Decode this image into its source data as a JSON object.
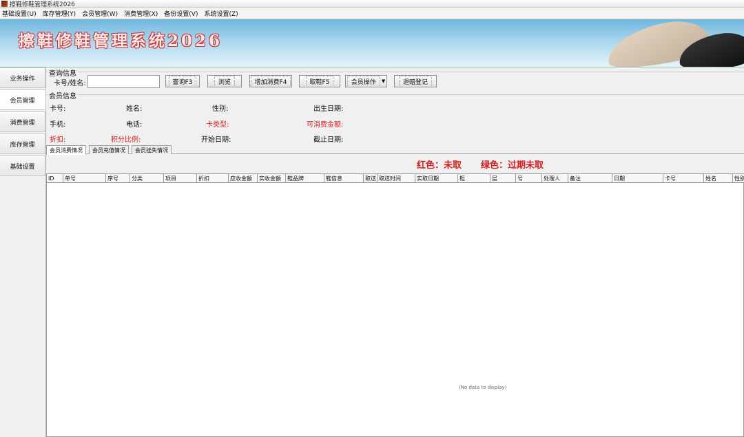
{
  "window": {
    "title": "擦鞋修鞋管理系统2026"
  },
  "menu": [
    "基础设置(U)",
    "库存管理(Y)",
    "会员管理(W)",
    "消费管理(X)",
    "备份设置(V)",
    "系统设置(Z)"
  ],
  "banner": {
    "title": "擦鞋修鞋管理系统2026"
  },
  "sidebar": {
    "items": [
      "业务操作",
      "会员管理",
      "消费管理",
      "库存管理",
      "基础设置"
    ],
    "active": 1
  },
  "query": {
    "group_label": "查询信息",
    "card_label": "卡号/姓名:",
    "card_value": "",
    "buttons": {
      "query": "查询F3",
      "browse": "浏览",
      "add_consume": "增加消费F4",
      "take_shoes": "取鞋F5",
      "member_ops": "会员操作",
      "refund": "退赔登记"
    }
  },
  "member": {
    "group_label": "会员信息",
    "fields": {
      "card_no": "卡号:",
      "name": "姓名:",
      "gender": "性别:",
      "birth": "出生日期:",
      "mobile": "手机:",
      "phone": "电话:",
      "card_type": "卡类型:",
      "balance": "可消费金额:",
      "discount": "折扣:",
      "points": "积分比例:",
      "start_date": "开始日期:",
      "end_date": "截止日期:"
    }
  },
  "tabs": [
    "会员消费情况",
    "会员充值情况",
    "会员挂失情况"
  ],
  "legend": {
    "red": "红色：未取",
    "green": "绿色：过期未取"
  },
  "grid": {
    "columns": [
      "ID",
      "单号",
      "序号",
      "分类",
      "项目",
      "折扣",
      "应收金额",
      "实收金额",
      "鞋品牌",
      "鞋信息",
      "取送",
      "取送时间",
      "实取日期",
      "柜",
      "层",
      "号",
      "处理人",
      "备注",
      "日期",
      "卡号",
      "姓名",
      "性别"
    ],
    "empty_text": "(No data to display)"
  },
  "colors": {
    "accent_red": "#d42020",
    "banner_blue": "#6fb5dd"
  }
}
